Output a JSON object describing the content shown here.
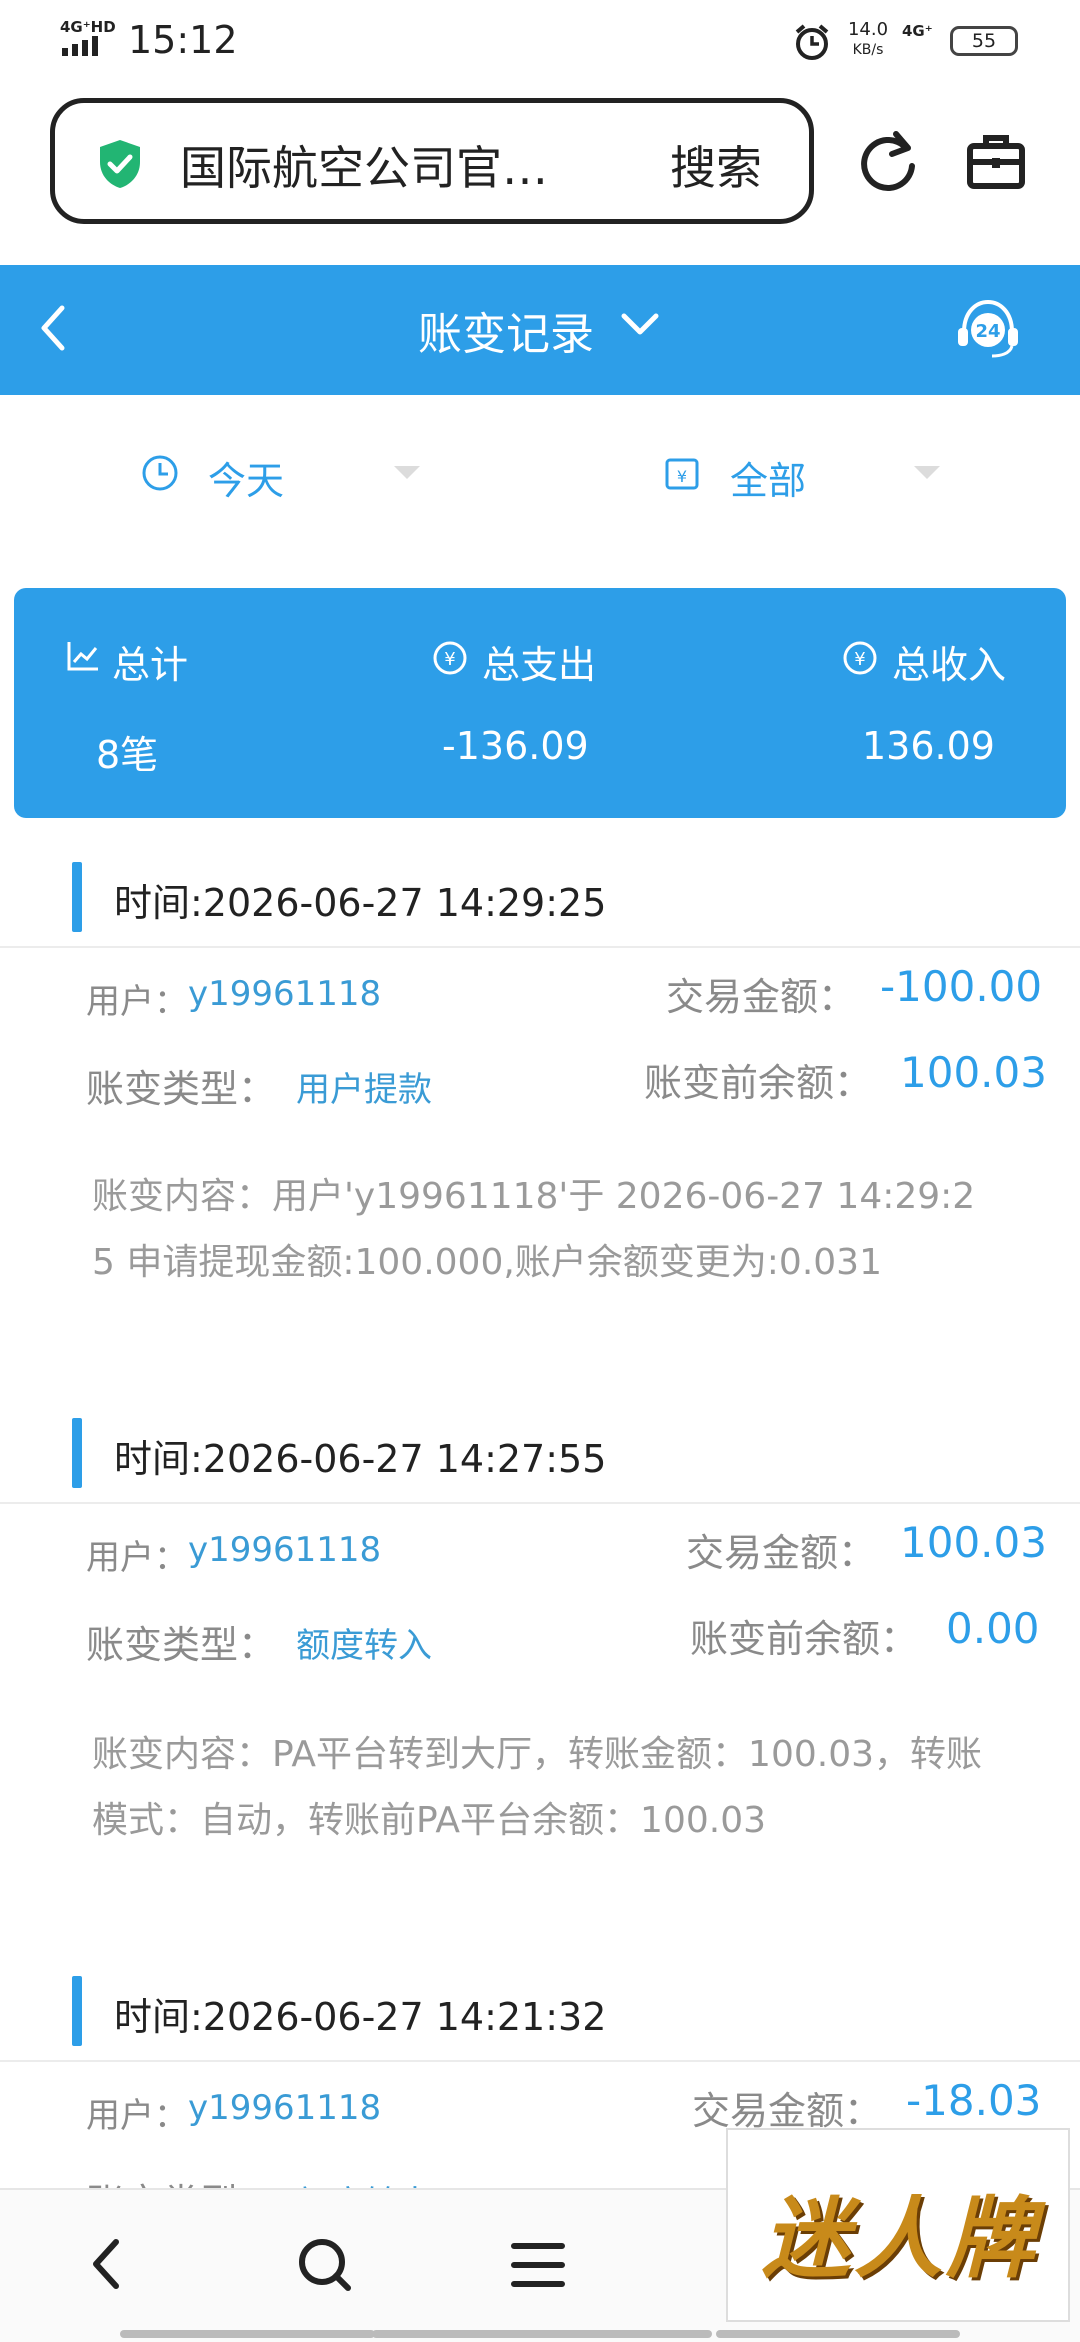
{
  "status_bar": {
    "network_label": "4G⁺HD",
    "time": "15:12",
    "speed_value": "14.0",
    "speed_unit": "KB/s",
    "network_type": "4G⁺",
    "battery": "55"
  },
  "browser": {
    "address_title": "国际航空公司官…",
    "search_label": "搜索"
  },
  "header": {
    "title": "账变记录"
  },
  "filters": {
    "date": "今天",
    "type": "全部"
  },
  "summary": {
    "total_label": "总计",
    "total_value": "8笔",
    "expense_label": "总支出",
    "expense_value": "-136.09",
    "income_label": "总收入",
    "income_value": "136.09"
  },
  "labels": {
    "user": "用户：",
    "amount": "交易金额：",
    "type": "账变类型：",
    "balance_before": "账变前余额：",
    "content": "账变内容："
  },
  "records": [
    {
      "time": "时间:2026-06-27 14:29:25",
      "user": "y19961118",
      "amount": "-100.00",
      "type": "用户提款",
      "balance_before": "100.03",
      "content": "账变内容：用户'y19961118'于 2026-06-27 14:29:25 申请提现金额:100.000,账户余额变更为:0.031"
    },
    {
      "time": "时间:2026-06-27 14:27:55",
      "user": "y19961118",
      "amount": "100.03",
      "type": "额度转入",
      "balance_before": "0.00",
      "content": "账变内容：PA平台转到大厅，转账金额：100.03，转账模式：自动，转账前PA平台余额：100.03"
    },
    {
      "time": "时间:2026-06-27 14:21:32",
      "user": "y19961118",
      "amount": "-18.03",
      "type": "额度转出",
      "balance_before": ""
    }
  ],
  "watermark": "迷人牌",
  "colors": {
    "accent": "#2d9ee8",
    "link": "#3a9bd5"
  }
}
